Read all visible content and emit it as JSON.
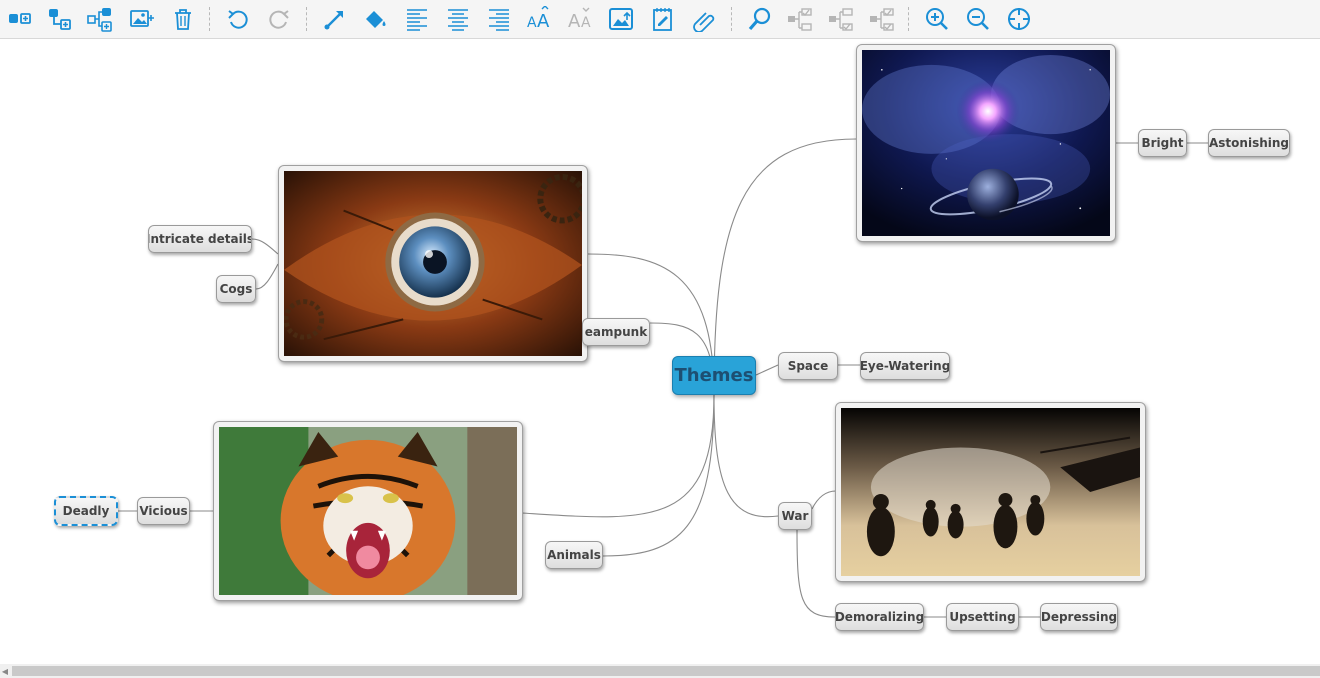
{
  "toolbar": {
    "buttons": [
      {
        "icon": "add-topic-icon"
      },
      {
        "icon": "add-subtopic-icon"
      },
      {
        "icon": "add-child-topics-icon"
      },
      {
        "icon": "add-image-icon"
      },
      {
        "icon": "delete-icon"
      },
      {
        "icon": "undo-icon"
      },
      {
        "icon": "redo-icon"
      },
      {
        "icon": "connector-icon"
      },
      {
        "icon": "fill-color-icon"
      },
      {
        "icon": "align-left-icon"
      },
      {
        "icon": "align-center-icon"
      },
      {
        "icon": "align-right-icon"
      },
      {
        "icon": "increase-font-icon"
      },
      {
        "icon": "decrease-font-icon"
      },
      {
        "icon": "insert-picture-icon"
      },
      {
        "icon": "note-icon"
      },
      {
        "icon": "link-icon"
      },
      {
        "icon": "find-icon"
      },
      {
        "icon": "expand-icon"
      },
      {
        "icon": "collapse-icon"
      },
      {
        "icon": "collapse-all-icon"
      },
      {
        "icon": "zoom-in-icon"
      },
      {
        "icon": "zoom-out-icon"
      },
      {
        "icon": "center-icon"
      }
    ],
    "accent_color": "#1b8fd6",
    "disabled_color": "#b5b5b5"
  },
  "mindmap": {
    "central": "Themes",
    "central_color": "#29a3d8",
    "nodes": {
      "steampunk": "eampunk",
      "intricate": "Intricate details",
      "cogs": "Cogs",
      "space": "Space",
      "eye_watering": "Eye-Watering",
      "bright": "Bright",
      "astonishing": "Astonishing",
      "animals": "Animals",
      "vicious": "Vicious",
      "deadly": "Deadly",
      "war": "War",
      "demoralizing": "Demoralizing",
      "upsetting": "Upsetting",
      "depressing": "Depressing"
    },
    "images": {
      "steampunk": "steampunk-eye-image",
      "space": "space-nebula-image",
      "animals": "tiger-image",
      "war": "war-soldiers-image"
    },
    "selected_node": "Deadly"
  }
}
